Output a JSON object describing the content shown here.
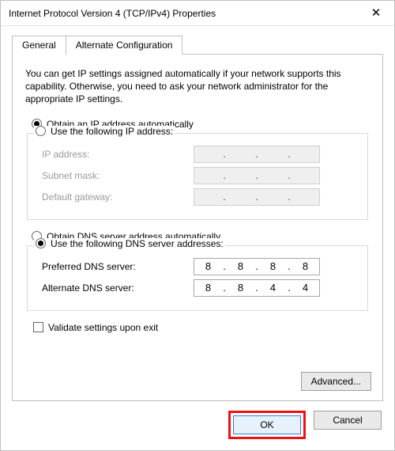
{
  "window": {
    "title": "Internet Protocol Version 4 (TCP/IPv4) Properties"
  },
  "tabs": {
    "general": "General",
    "alternate": "Alternate Configuration"
  },
  "intro": "You can get IP settings assigned automatically if your network supports this capability. Otherwise, you need to ask your network administrator for the appropriate IP settings.",
  "ip": {
    "auto_label": "Obtain an IP address automatically",
    "manual_label": "Use the following IP address:",
    "ip_label": "IP address:",
    "subnet_label": "Subnet mask:",
    "gateway_label": "Default gateway:",
    "ip_value": [
      "",
      "",
      "",
      ""
    ],
    "subnet_value": [
      "",
      "",
      "",
      ""
    ],
    "gateway_value": [
      "",
      "",
      "",
      ""
    ],
    "auto_selected": true
  },
  "dns": {
    "auto_label": "Obtain DNS server address automatically",
    "manual_label": "Use the following DNS server addresses:",
    "preferred_label": "Preferred DNS server:",
    "alternate_label": "Alternate DNS server:",
    "preferred_value": [
      "8",
      "8",
      "8",
      "8"
    ],
    "alternate_value": [
      "8",
      "8",
      "4",
      "4"
    ],
    "manual_selected": true
  },
  "validate_label": "Validate settings upon exit",
  "buttons": {
    "advanced": "Advanced...",
    "ok": "OK",
    "cancel": "Cancel"
  }
}
